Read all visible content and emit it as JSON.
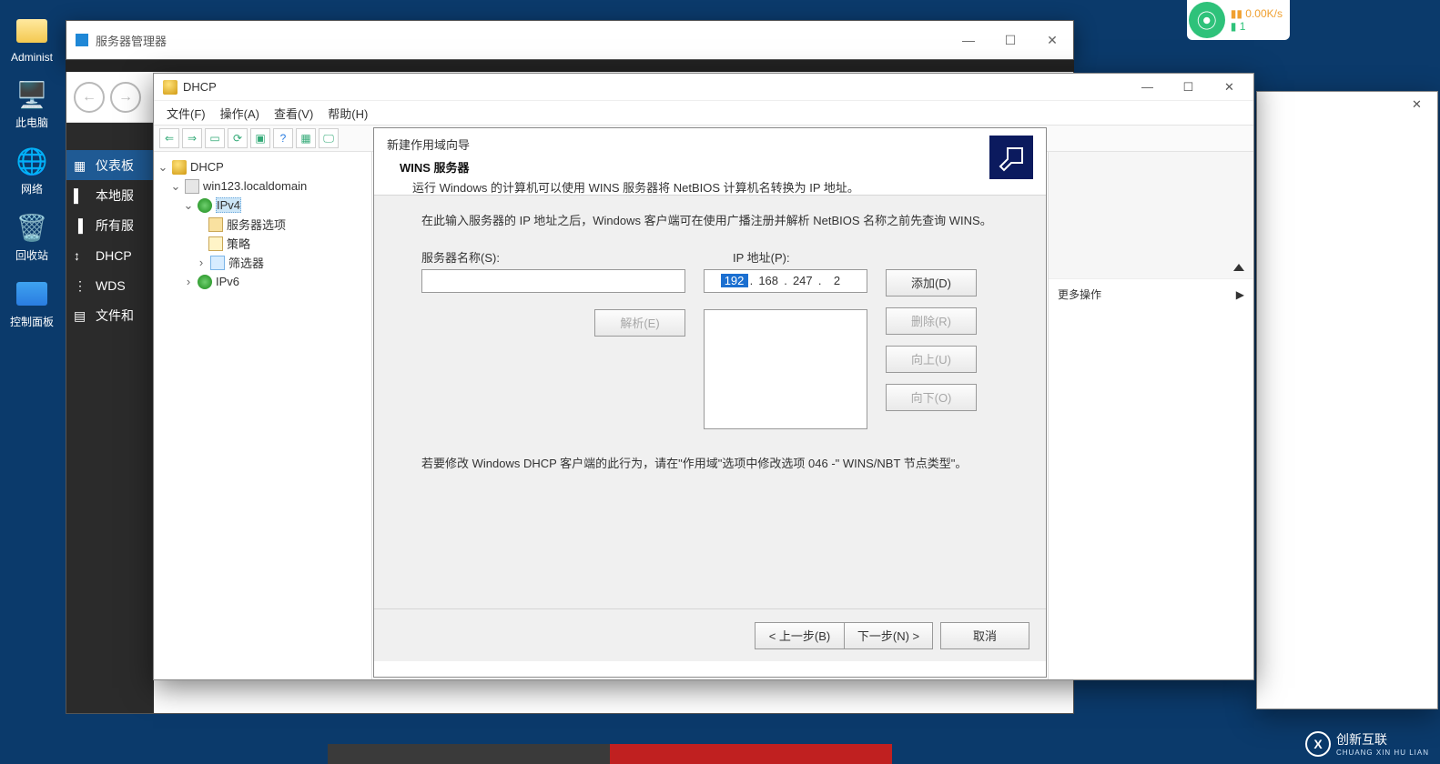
{
  "desktop": {
    "icons": [
      "Administ",
      "此电脑",
      "网络",
      "回收站",
      "控制面板"
    ]
  },
  "netwidget": {
    "up": "0.00K/s",
    "dn": "1"
  },
  "server_manager": {
    "title": "服务器管理器",
    "sidebar": [
      "仪表板",
      "本地服",
      "所有服",
      "DHCP",
      "WDS",
      "文件和"
    ]
  },
  "mmc": {
    "title": "DHCP",
    "menu": [
      "文件(F)",
      "操作(A)",
      "查看(V)",
      "帮助(H)"
    ],
    "tree": {
      "root": "DHCP",
      "server": "win123.localdomain",
      "ipv4": "IPv4",
      "children": [
        "服务器选项",
        "策略",
        "筛选器"
      ],
      "ipv6": "IPv6"
    },
    "actions_more": "更多操作"
  },
  "wizard": {
    "breadcrumb": "新建作用域向导",
    "heading": "WINS 服务器",
    "subheading": "运行 Windows 的计算机可以使用 WINS 服务器将 NetBIOS 计算机名转换为 IP 地址。",
    "desc": "在此输入服务器的 IP 地址之后，Windows 客户端可在使用广播注册并解析 NetBIOS 名称之前先查询 WINS。",
    "label_server": "服务器名称(S):",
    "label_ip": "IP 地址(P):",
    "btn_resolve": "解析(E)",
    "btn_add": "添加(D)",
    "btn_remove": "删除(R)",
    "btn_up": "向上(U)",
    "btn_down": "向下(O)",
    "ip": {
      "o1": "192",
      "o2": "168",
      "o3": "247",
      "o4": "2"
    },
    "hint2": "若要修改 Windows DHCP 客户端的此行为，请在\"作用域\"选项中修改选项 046 -\" WINS/NBT 节点类型\"。",
    "btn_back": "< 上一步(B)",
    "btn_next": "下一步(N) >",
    "btn_cancel": "取消"
  },
  "watermark": {
    "big": "创新互联",
    "small": "CHUANG XIN HU LIAN"
  }
}
